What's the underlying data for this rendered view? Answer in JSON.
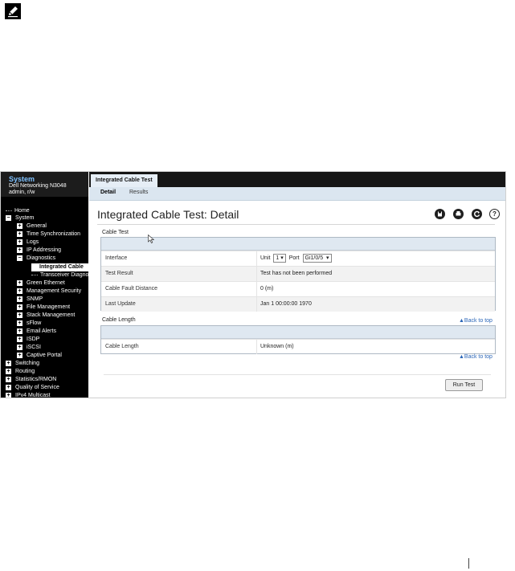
{
  "nav": {
    "title": "System",
    "device": "Dell Networking N3048",
    "user": "admin, r/w",
    "items": [
      {
        "label": "Home"
      },
      {
        "label": "System"
      },
      {
        "label": "General"
      },
      {
        "label": "Time Synchronization"
      },
      {
        "label": "Logs"
      },
      {
        "label": "IP Addressing"
      },
      {
        "label": "Diagnostics"
      },
      {
        "label": "Integrated Cable"
      },
      {
        "label": "Transceiver Diagno"
      },
      {
        "label": "Green Ethernet"
      },
      {
        "label": "Management Security"
      },
      {
        "label": "SNMP"
      },
      {
        "label": "File Management"
      },
      {
        "label": "Stack Management"
      },
      {
        "label": "sFlow"
      },
      {
        "label": "Email Alerts"
      },
      {
        "label": "ISDP"
      },
      {
        "label": "iSCSI"
      },
      {
        "label": "Captive Portal"
      },
      {
        "label": "Switching"
      },
      {
        "label": "Routing"
      },
      {
        "label": "Statistics/RMON"
      },
      {
        "label": "Quality of Service"
      },
      {
        "label": "IPv4 Multicast"
      }
    ]
  },
  "main": {
    "tab": "Integrated Cable Test",
    "subtabs": [
      "Detail",
      "Results"
    ],
    "title": "Integrated Cable Test: Detail",
    "cable_test": {
      "label": "Cable Test",
      "rows": [
        {
          "label": "Interface",
          "unit_label": "Unit",
          "unit_value": "1",
          "port_label": "Port",
          "port_value": "Gi1/0/5"
        },
        {
          "label": "Test Result",
          "value": "Test has not been performed"
        },
        {
          "label": "Cable Fault Distance",
          "value": "0  (m)"
        },
        {
          "label": "Last Update",
          "value": "Jan 1 00:00:00 1970"
        }
      ]
    },
    "cable_length": {
      "label": "Cable Length",
      "rows": [
        {
          "label": "Cable Length",
          "value": "Unknown  (m)"
        }
      ]
    },
    "back_to_top": "▲Back to top",
    "run_test": "Run Test"
  },
  "icons": {
    "save": "floppy-icon",
    "print": "printer-icon",
    "refresh": "refresh-icon",
    "help": "help-icon"
  }
}
